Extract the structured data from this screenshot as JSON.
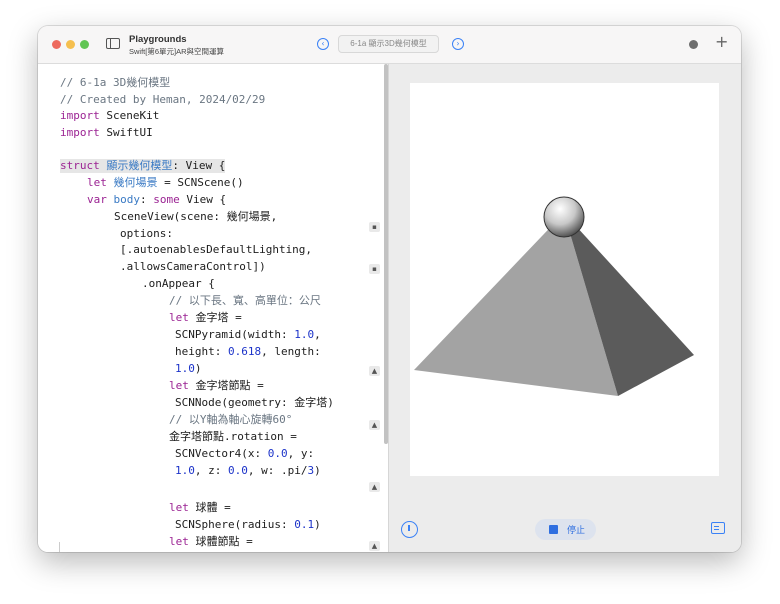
{
  "window": {
    "app_title": "Playgrounds",
    "subtitle": "Swift[第6單元]AR與空間運算",
    "page_title": "6-1a 顯示3D幾何模型",
    "nav_back": "‹",
    "nav_forward": "›",
    "plus": "+"
  },
  "code": {
    "line1": "// 6-1a 3D幾何模型",
    "line2": "// Created by Heman, 2024/02/29",
    "import_kw": "import",
    "import1": "SceneKit",
    "import2": "SwiftUI",
    "struct_kw": "struct",
    "struct_name": "顯示幾何模型",
    "struct_rest": ": View {",
    "let_kw": "let",
    "var_kw": "var",
    "some_kw": "some",
    "scene_var": "幾何場景",
    "scene_init": " = SCNScene()",
    "body_name": "body",
    "body_colon": ": ",
    "body_type": " View {",
    "sceneview": "SceneView(scene: 幾何場景,",
    "options": "options:",
    "lighting": "[.autoenablesDefaultLighting,",
    "camera": ".allowsCameraControl])",
    "onappear": ".onAppear {",
    "cmt_units": "// 以下長、寬、高單位：公尺",
    "pyramid_var": " 金字塔 =",
    "pyramid1": "SCNPyramid(width: ",
    "w_val": "1.0",
    "comma": ",",
    "height_label": "height: ",
    "h_val": "0.618",
    "length_label": ", length:",
    "l_val": "1.0",
    "close_paren": ")",
    "node_var": " 金字塔節點 =",
    "node_init": "SCNNode(geometry: 金字塔)",
    "cmt_rotate": "// 以Y軸為軸心旋轉60°",
    "rotation": "金字塔節點.rotation =",
    "vec_a": "SCNVector4(x: ",
    "x_val": "0.0",
    "y_label": ", y:",
    "y_val": "1.0",
    "z_label": ", z: ",
    "z_val": "0.0",
    "w_label": ", w: .pi/",
    "w_div": "3",
    "sphere_var": " 球體 =",
    "sphere_init": "SCNSphere(radius: ",
    "r_val": "0.1",
    "sphere_node": " 球體節點 ="
  },
  "result_icons": {
    "cube": "cube-icon",
    "image": "photo-icon"
  },
  "preview": {
    "stop_label": "停止"
  },
  "colors": {
    "keyword": "#9b2393",
    "comment": "#6a7682",
    "number": "#1c33c9",
    "accent": "#3b82f6"
  }
}
